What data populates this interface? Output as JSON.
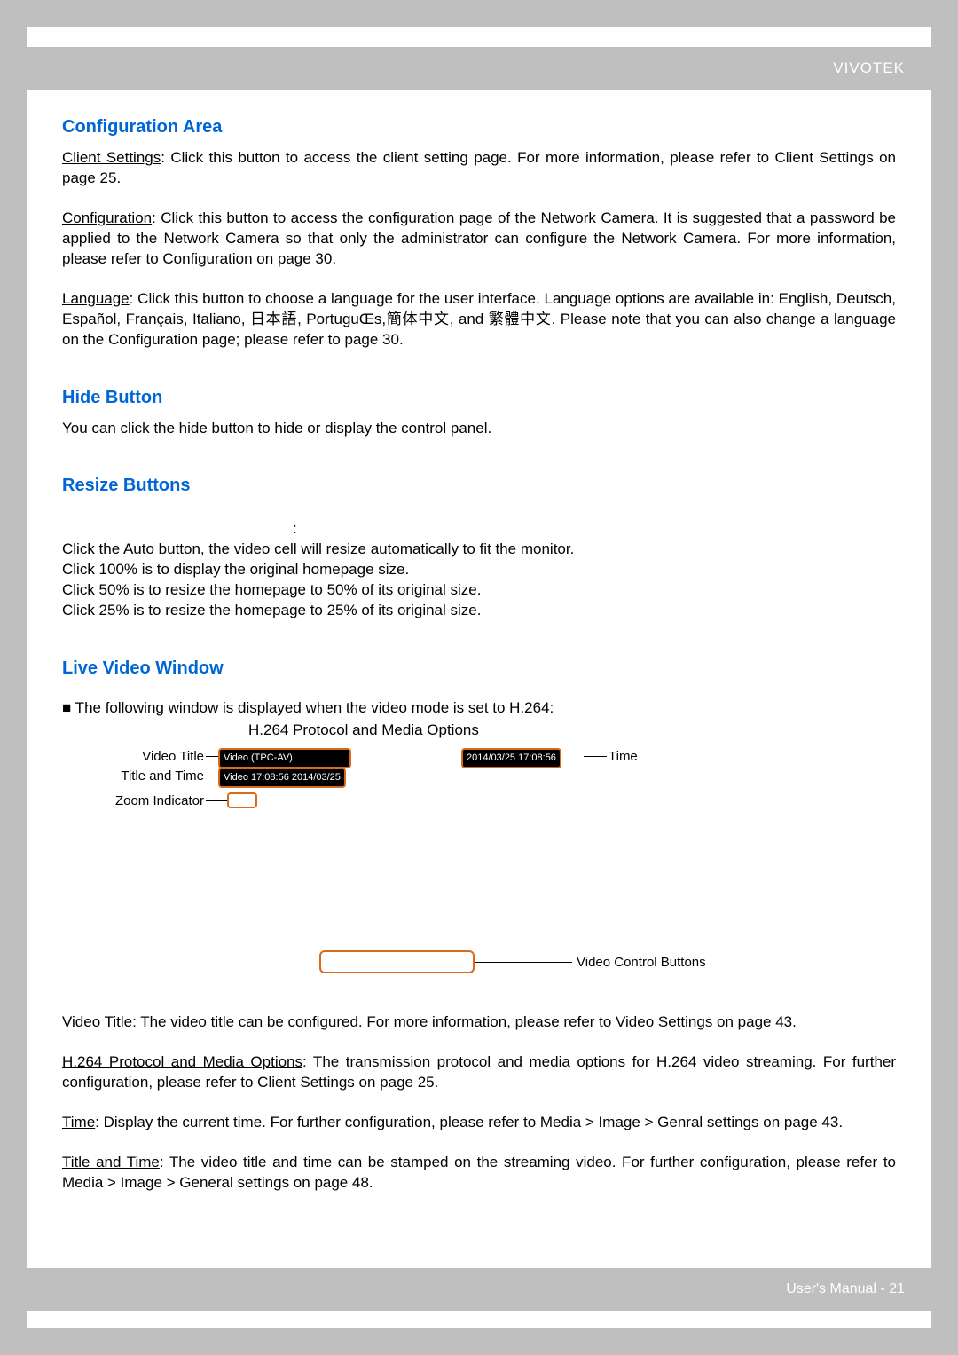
{
  "header": {
    "brand": "VIVOTEK"
  },
  "footer": {
    "text": "User's Manual - 21"
  },
  "sections": {
    "config_area_title": "Configuration Area",
    "client_settings_label": "Client Settings",
    "client_settings_text": ": Click this button to access the client setting page. For more information, please refer to Client Settings on page 25.",
    "configuration_label": "Configuration",
    "configuration_text": ": Click this button to access the configuration page of the Network Camera. It is suggested that a password be applied to the Network Camera so that only the administrator can configure the Network Camera. For more information, please refer to Configuration on page 30.",
    "language_label": "Language",
    "language_text": ": Click this button to choose a language for the user interface. Language options are available in: English, Deutsch, Español, Français, Italiano, 日本語, PortuguŒs,簡体中文, and 繁體中文.  Please note that you can also change a language on the Configuration page; please refer to page 30.",
    "hide_button_title": "Hide Button",
    "hide_button_text": "You can click the hide button to hide or display the control panel.",
    "resize_buttons_title": "Resize Buttons",
    "resize_colon": ":",
    "resize_line1": "Click the Auto button, the video cell will resize automatically to fit the monitor.",
    "resize_line2": "Click 100% is to display the original homepage size.",
    "resize_line3": "Click 50% is to resize the homepage to 50% of its original size.",
    "resize_line4": "Click 25% is to resize the homepage to 25% of its original size.",
    "live_video_title": "Live Video Window",
    "bullet_h264": "■ The following window is displayed when the video mode is set to H.264:",
    "caption_h264": "H.264 Protocol and Media Options"
  },
  "diagram": {
    "label_video_title": "Video Title",
    "label_title_time": "Title and Time",
    "label_zoom": "Zoom Indicator",
    "label_time": "Time",
    "label_vcb": "Video Control Buttons",
    "box_video_tpc": "Video (TPC-AV)",
    "box_title_time_val": "Video 17:08:56  2014/03/25",
    "box_time_val": "2014/03/25  17:08:56"
  },
  "bottom_paragraphs": {
    "vt_label": "Video Title",
    "vt_text": ": The video title can be configured. For more information, please refer to Video Settings on page 43.",
    "hp_label": "H.264 Protocol and Media Options",
    "hp_text": ": The transmission protocol and media options for H.264 video streaming. For further configuration, please refer to Client Settings on page 25.",
    "tm_label": "Time",
    "tm_text": ": Display the current time. For further configuration, please refer to Media > Image > Genral settings on page 43.",
    "tt_label": "Title and Time",
    "tt_text": ": The video title and time can be stamped on the streaming video. For further configuration, please refer to Media > Image > General settings on page 48."
  }
}
